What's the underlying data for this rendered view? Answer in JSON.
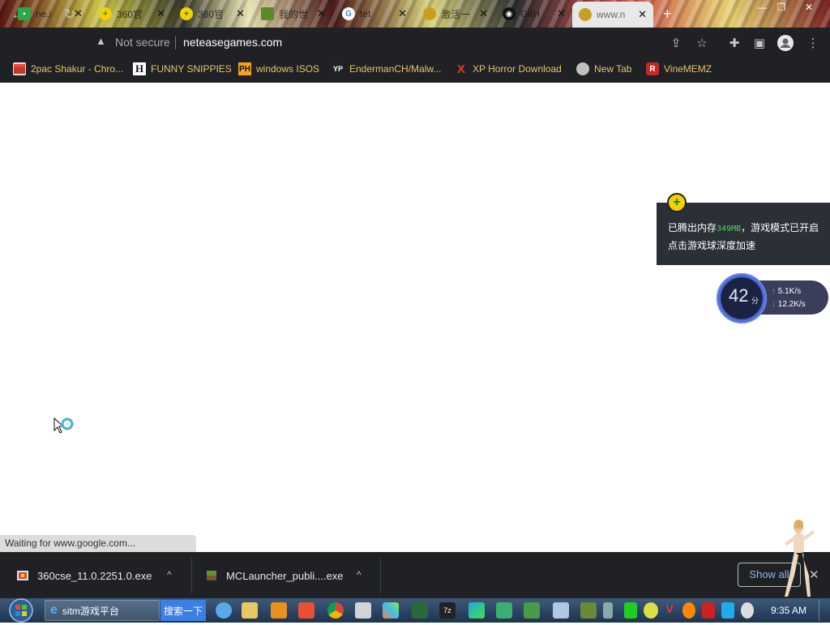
{
  "tabs": [
    {
      "label": "ne.i",
      "icon": "chat-icon",
      "color": "#2aa84a"
    },
    {
      "label": "360官",
      "icon": "plus-ball-icon",
      "color": "#f0d200"
    },
    {
      "label": "360官",
      "icon": "plus-ball-icon",
      "color": "#f0d200"
    },
    {
      "label": "我的世",
      "icon": "grass-block-icon",
      "color": "#5a8a2a"
    },
    {
      "label": "tet",
      "icon": "google-icon",
      "color": "#4285f4"
    },
    {
      "label": "激活一",
      "icon": "coin-icon",
      "color": "#c8a020"
    },
    {
      "label": "GitH",
      "icon": "github-icon",
      "color": "#111111"
    },
    {
      "label": "www.n",
      "icon": "coin-icon",
      "color": "#c8a020",
      "active": true
    }
  ],
  "toolbar": {
    "security_label": "Not secure",
    "url": "neteasegames.com"
  },
  "bookmarks": [
    {
      "label": "2pac Shakur - Chro...",
      "icon": "store-icon"
    },
    {
      "label": "FUNNY SNIPPIES",
      "icon": "h-icon"
    },
    {
      "label": "windows ISOS",
      "icon": "ph-icon"
    },
    {
      "label": "EndermanCH/Malw...",
      "icon": "yp-icon"
    },
    {
      "label": "XP Horror Download",
      "icon": "x-icon"
    },
    {
      "label": "New Tab",
      "icon": "globe-icon"
    },
    {
      "label": "VineMEMZ",
      "icon": "r-icon"
    }
  ],
  "status_text": "Waiting for www.google.com...",
  "popup": {
    "line1_prefix": "已腾出内存",
    "memory": "349MB",
    "line1_suffix": "，游戏模式已开启",
    "line2": "点击游戏球深度加速"
  },
  "speed": {
    "score": "42",
    "unit": "分",
    "upload": "5.1K/s",
    "download": "12.2K/s"
  },
  "downloads": [
    {
      "name": "360cse_11.0.2251.0.exe"
    },
    {
      "name": "MCLauncher_publi....exe"
    }
  ],
  "download_bar": {
    "show_all": "Show all"
  },
  "taskbar": {
    "app_label": "sitm游戏平台",
    "search_label": "搜索一下",
    "clock": "9:35 AM"
  }
}
